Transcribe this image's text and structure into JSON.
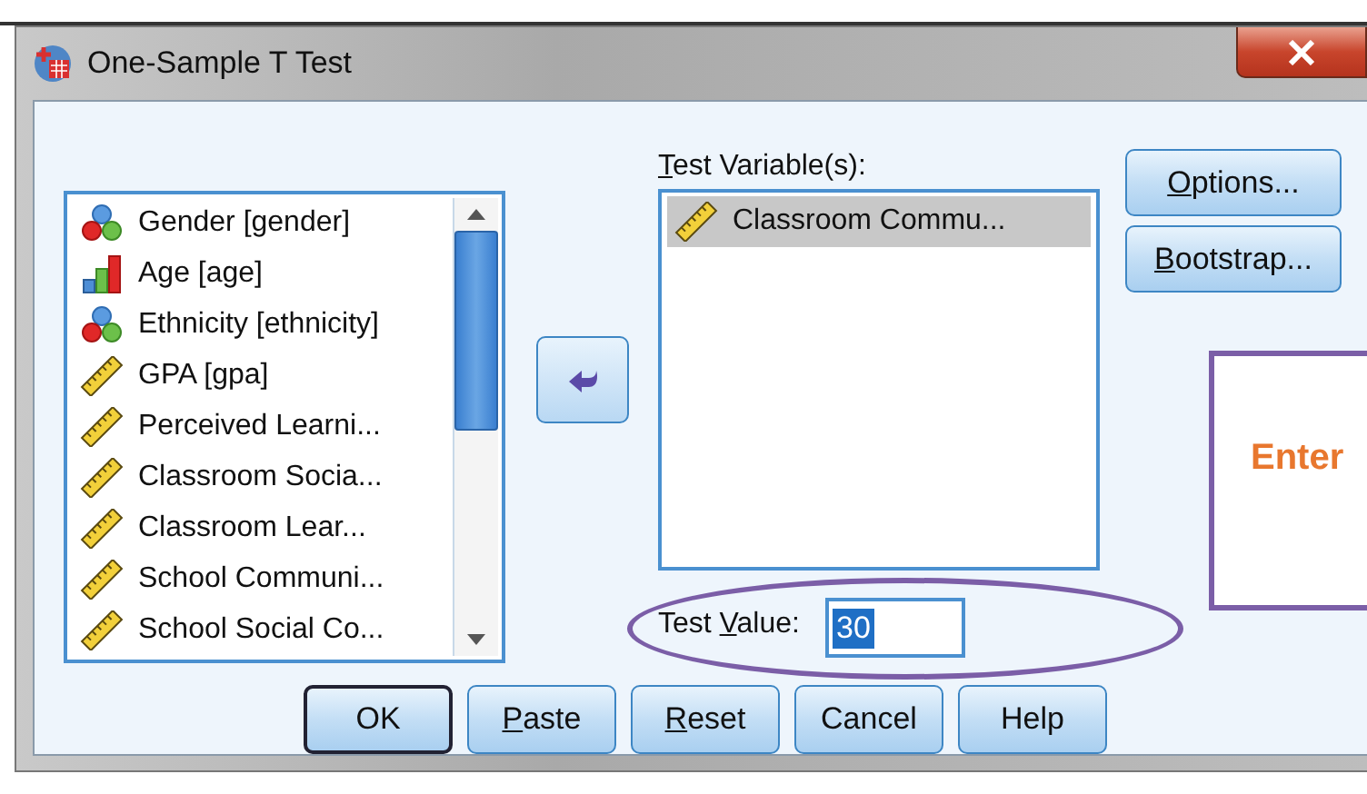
{
  "window": {
    "title": "One-Sample T Test"
  },
  "source_list": {
    "items": [
      {
        "label": "Gender [gender]",
        "kind": "nominal"
      },
      {
        "label": "Age [age]",
        "kind": "ordinal"
      },
      {
        "label": "Ethnicity [ethnicity]",
        "kind": "nominal"
      },
      {
        "label": "GPA [gpa]",
        "kind": "scale"
      },
      {
        "label": "Perceived Learni...",
        "kind": "scale"
      },
      {
        "label": "Classroom Socia...",
        "kind": "scale"
      },
      {
        "label": "Classroom Lear...",
        "kind": "scale"
      },
      {
        "label": "School Communi...",
        "kind": "scale"
      },
      {
        "label": "School Social Co...",
        "kind": "scale"
      }
    ]
  },
  "test_variables": {
    "label": {
      "key": "T",
      "after": "est Variable(s):"
    },
    "items": [
      {
        "label": "Classroom Commu...",
        "kind": "scale",
        "selected": true
      }
    ]
  },
  "side_buttons": [
    {
      "label": {
        "key": "O",
        "after": "ptions..."
      }
    },
    {
      "label": {
        "key": "B",
        "after": "ootstrap..."
      }
    }
  ],
  "test_value": {
    "label": {
      "before": "Test ",
      "key": "V",
      "after": "alue:"
    },
    "value": "30",
    "value_selected": true
  },
  "buttons": [
    {
      "label": "OK",
      "default": true
    },
    {
      "label": {
        "key": "P",
        "after": "aste"
      },
      "default": false
    },
    {
      "label": {
        "key": "R",
        "after": "eset"
      },
      "default": false
    },
    {
      "label": "Cancel",
      "default": false
    },
    {
      "label": "Help",
      "default": false
    }
  ],
  "annotation": {
    "text": "Enter"
  }
}
